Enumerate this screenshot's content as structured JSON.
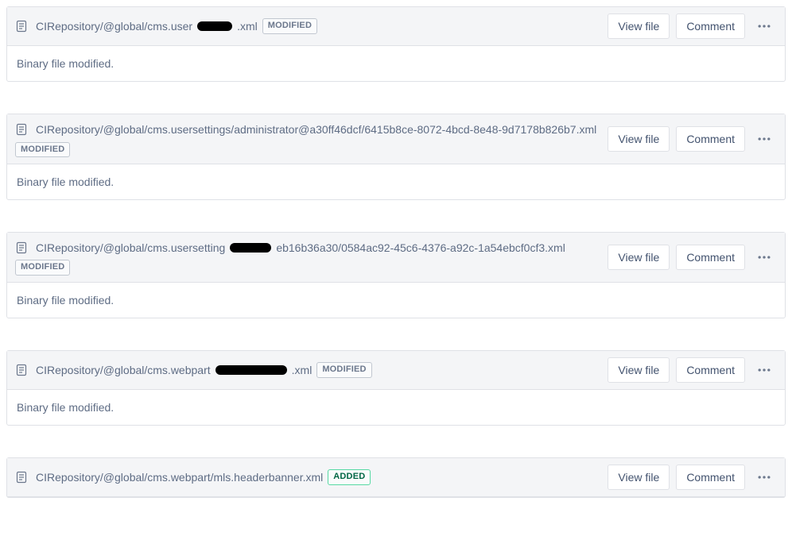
{
  "buttons": {
    "view_file": "View file",
    "comment": "Comment"
  },
  "badges": {
    "modified": "MODIFIED",
    "added": "ADDED"
  },
  "body_text": {
    "binary_modified": "Binary file modified."
  },
  "items": [
    {
      "path_prefix": "CIRepository/@global/cms.user",
      "redacted_width": 44,
      "path_suffix": ".xml",
      "status": "modified",
      "body": "binary_modified"
    },
    {
      "path_prefix": "CIRepository/@global/cms.usersettings/administrator@a30ff46dcf/6415b8ce-8072-4bcd-8e48-9d7178b826b7.xml",
      "redacted_width": 0,
      "path_suffix": "",
      "status": "modified",
      "body": "binary_modified"
    },
    {
      "path_prefix": "CIRepository/@global/cms.usersetting",
      "redacted_width": 52,
      "path_suffix": "eb16b36a30/0584ac92-45c6-4376-a92c-1a54ebcf0cf3.xml",
      "status": "modified",
      "body": "binary_modified"
    },
    {
      "path_prefix": "CIRepository/@global/cms.webpart",
      "redacted_width": 90,
      "path_suffix": ".xml",
      "status": "modified",
      "body": "binary_modified"
    },
    {
      "path_prefix": "CIRepository/@global/cms.webpart/mls.headerbanner.xml",
      "redacted_width": 0,
      "path_suffix": "",
      "status": "added",
      "body": ""
    }
  ]
}
